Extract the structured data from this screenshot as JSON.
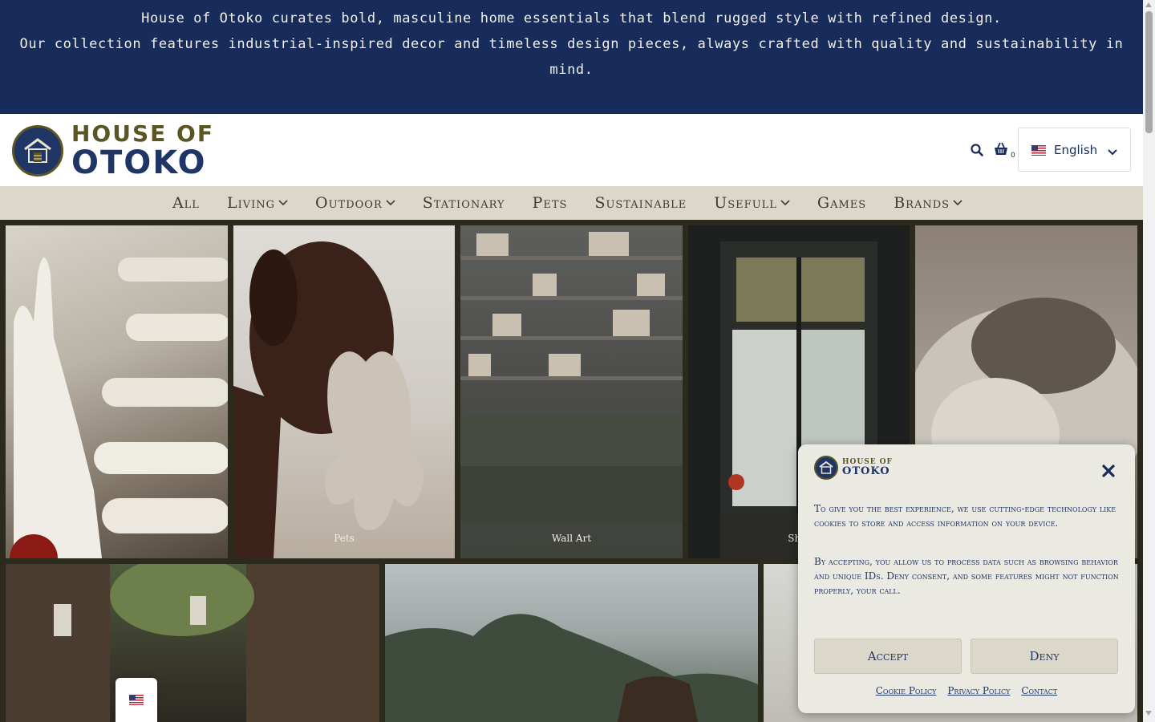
{
  "announcement": {
    "line1": "House of Otoko curates bold, masculine home essentials that blend rugged style with refined design.",
    "line2": "Our collection features industrial-inspired decor and timeless design pieces, always crafted with quality and sustainability in mind."
  },
  "header": {
    "logo_line1": "HOUSE OF",
    "logo_line2": "OTOKO",
    "cart_count": "0",
    "language": "English",
    "icons": [
      "search-icon",
      "basket-icon",
      "us-flag-icon",
      "chevron-down-icon"
    ]
  },
  "nav": {
    "items": [
      {
        "label": "All",
        "has_dropdown": false
      },
      {
        "label": "Living",
        "has_dropdown": true
      },
      {
        "label": "Outdoor",
        "has_dropdown": true
      },
      {
        "label": "Stationary",
        "has_dropdown": false
      },
      {
        "label": "Pets",
        "has_dropdown": false
      },
      {
        "label": "Sustainable",
        "has_dropdown": false
      },
      {
        "label": "Usefull",
        "has_dropdown": true
      },
      {
        "label": "Games",
        "has_dropdown": false
      },
      {
        "label": "Brands",
        "has_dropdown": true
      }
    ]
  },
  "tiles": {
    "row1": [
      {
        "label": ""
      },
      {
        "label": "Pets"
      },
      {
        "label": "Wall Art"
      },
      {
        "label": "Ship"
      },
      {
        "label": ""
      }
    ]
  },
  "cookie": {
    "logo_line1": "HOUSE OF",
    "logo_line2": "OTOKO",
    "para1": "To give you the best experience, we use cutting-edge technology like cookies to store and access information on your device.",
    "para2": "By accepting, you allow us to process data such as browsing behavior and unique IDs. Deny consent, and some features might not function properly, your call.",
    "accept": "Accept",
    "deny": "Deny",
    "links": [
      "Cookie Policy",
      "Privacy Policy",
      "Contact"
    ]
  },
  "colors": {
    "navy": "#172c5a",
    "olive": "#5a5523",
    "nav_bg": "#dcd8c9",
    "page_bg": "#2b2a1d"
  }
}
